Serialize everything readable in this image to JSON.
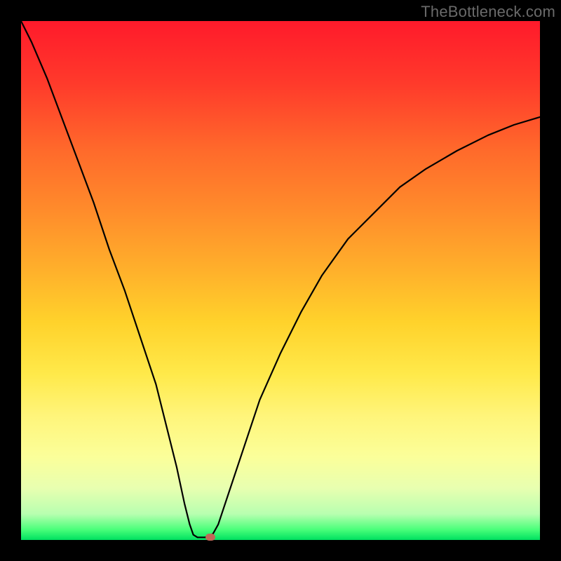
{
  "watermark": "TheBottleneck.com",
  "chart_data": {
    "type": "line",
    "title": "",
    "xlabel": "",
    "ylabel": "",
    "xlim": [
      0,
      100
    ],
    "ylim": [
      0,
      100
    ],
    "curve": [
      {
        "x": 0,
        "y": 100
      },
      {
        "x": 2,
        "y": 96
      },
      {
        "x": 5,
        "y": 89
      },
      {
        "x": 8,
        "y": 81
      },
      {
        "x": 11,
        "y": 73
      },
      {
        "x": 14,
        "y": 65
      },
      {
        "x": 17,
        "y": 56
      },
      {
        "x": 20,
        "y": 48
      },
      {
        "x": 23,
        "y": 39
      },
      {
        "x": 26,
        "y": 30
      },
      {
        "x": 28,
        "y": 22
      },
      {
        "x": 30,
        "y": 14
      },
      {
        "x": 31.5,
        "y": 7
      },
      {
        "x": 32.5,
        "y": 3
      },
      {
        "x": 33.2,
        "y": 1
      },
      {
        "x": 34.0,
        "y": 0.5
      },
      {
        "x": 35.5,
        "y": 0.5
      },
      {
        "x": 37.0,
        "y": 1.2
      },
      {
        "x": 38.0,
        "y": 3
      },
      {
        "x": 40,
        "y": 9
      },
      {
        "x": 43,
        "y": 18
      },
      {
        "x": 46,
        "y": 27
      },
      {
        "x": 50,
        "y": 36
      },
      {
        "x": 54,
        "y": 44
      },
      {
        "x": 58,
        "y": 51
      },
      {
        "x": 63,
        "y": 58
      },
      {
        "x": 68,
        "y": 63
      },
      {
        "x": 73,
        "y": 68
      },
      {
        "x": 78,
        "y": 71.5
      },
      {
        "x": 84,
        "y": 75
      },
      {
        "x": 90,
        "y": 78
      },
      {
        "x": 95,
        "y": 80
      },
      {
        "x": 100,
        "y": 81.5
      }
    ],
    "marker": {
      "x": 36.5,
      "y": 0.6,
      "color": "#c06858"
    }
  }
}
